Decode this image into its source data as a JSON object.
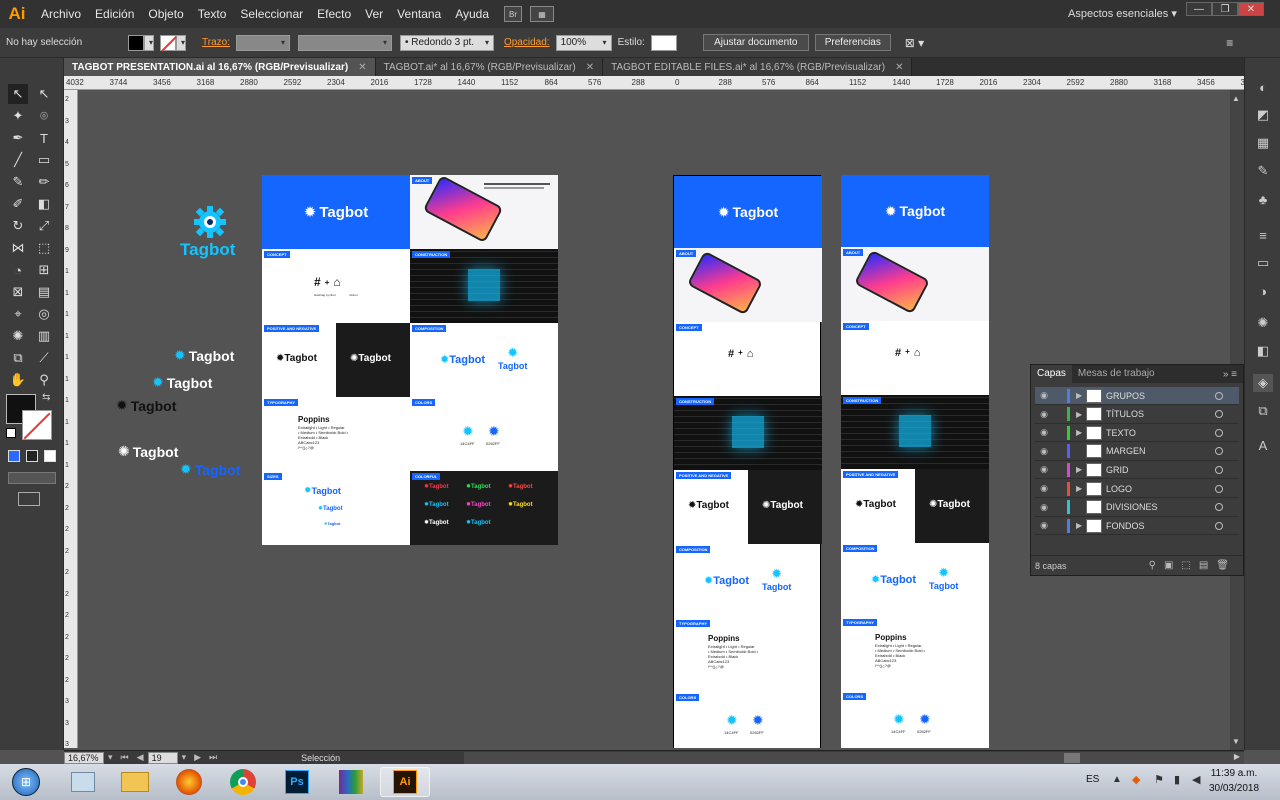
{
  "app": {
    "logo": "Ai",
    "workspace": "Aspectos esenciales"
  },
  "menu": [
    "Archivo",
    "Edición",
    "Objeto",
    "Texto",
    "Seleccionar",
    "Efecto",
    "Ver",
    "Ventana",
    "Ayuda"
  ],
  "menu_box": "Br",
  "window_buttons": [
    "—",
    "❐",
    "✕"
  ],
  "control": {
    "selection": "No hay selección",
    "stroke_label": "Trazo:",
    "brush": "Redondo 3 pt.",
    "opacity_label": "Opacidad:",
    "opacity": "100%",
    "style_label": "Estilo:",
    "fit_button": "Ajustar documento",
    "prefs_button": "Preferencias"
  },
  "tabs": [
    {
      "label": "TAGBOT PRESENTATION.ai al 16,67% (RGB/Previsualizar)",
      "active": true
    },
    {
      "label": "TAGBOT.ai* al 16,67% (RGB/Previsualizar)",
      "active": false
    },
    {
      "label": "TAGBOT EDITABLE FILES.ai* al 16,67% (RGB/Previsualizar)",
      "active": false
    }
  ],
  "ruler_ticks": [
    "4032",
    "3744",
    "3456",
    "3168",
    "2880",
    "2592",
    "2304",
    "2016",
    "1728",
    "1440",
    "1152",
    "864",
    "576",
    "288",
    "0",
    "288",
    "576",
    "864",
    "1152",
    "1440",
    "1728",
    "2016",
    "2304",
    "2592",
    "2880",
    "3168",
    "3456",
    "3744"
  ],
  "ruler_v_ticks": [
    "2",
    "3",
    "4",
    "5",
    "6",
    "7",
    "8",
    "9",
    "1",
    "1",
    "1",
    "1",
    "1",
    "1",
    "1",
    "1",
    "1",
    "1",
    "2",
    "2",
    "2",
    "2",
    "2",
    "2",
    "2",
    "2",
    "2",
    "2",
    "3",
    "3",
    "3"
  ],
  "canvas": {
    "brand": "Tagbot",
    "labels": {
      "about": "ABOUT",
      "concept": "CONCEPT",
      "construction": "CONSTRUCTION",
      "positive": "POSITIVE AND NEGATIVE",
      "composition": "COMPOSITION",
      "typography": "TYPOGRAPHY",
      "colors": "COLORS",
      "sizes": "SIZES",
      "colorful": "COLORFUL"
    },
    "font_name": "Poppins",
    "font_line1": "Extralight • Light • Regular",
    "font_line2": "• Medium • Semibold• Bold •",
    "font_line3": "Extrabold • Black",
    "font_sample": "ABCabc123",
    "font_glyphs": "/*^()¿?@",
    "concept_hashtag": "#",
    "concept_plus": "+",
    "concept_robot": "⌂",
    "concept_sub1": "Hashtag symbol",
    "concept_sub2": "Robot",
    "color_codes": [
      "14C4FF",
      "0262FF"
    ]
  },
  "layers_panel": {
    "tabs": [
      "Capas",
      "Mesas de trabajo"
    ],
    "layers": [
      {
        "name": "GRUPOS",
        "color": "#4f7fd6",
        "expandable": true,
        "selected": true
      },
      {
        "name": "TÍTULOS",
        "color": "#3bb24b",
        "expandable": true,
        "selected": false
      },
      {
        "name": "TEXTO",
        "color": "#33cc33",
        "expandable": true,
        "selected": false
      },
      {
        "name": "MARGEN",
        "color": "#5b5bff",
        "expandable": false,
        "selected": false
      },
      {
        "name": "GRID",
        "color": "#d04bd0",
        "expandable": true,
        "selected": false
      },
      {
        "name": "LOGO",
        "color": "#e0503c",
        "expandable": true,
        "selected": false
      },
      {
        "name": "DIVISIONES",
        "color": "#2ec4d6",
        "expandable": false,
        "selected": false
      },
      {
        "name": "FONDOS",
        "color": "#4f7fd6",
        "expandable": true,
        "selected": false
      }
    ],
    "count": "8 capas"
  },
  "status": {
    "zoom": "16,67%",
    "artboard": "19",
    "tool": "Selección"
  },
  "taskbar": {
    "lang": "ES",
    "time": "11:39 a.m.",
    "date": "30/03/2018"
  },
  "colors": {
    "brand_blue": "#1565ff",
    "accent_cyan": "#14c4ff",
    "ai_orange": "#ff9a00"
  }
}
